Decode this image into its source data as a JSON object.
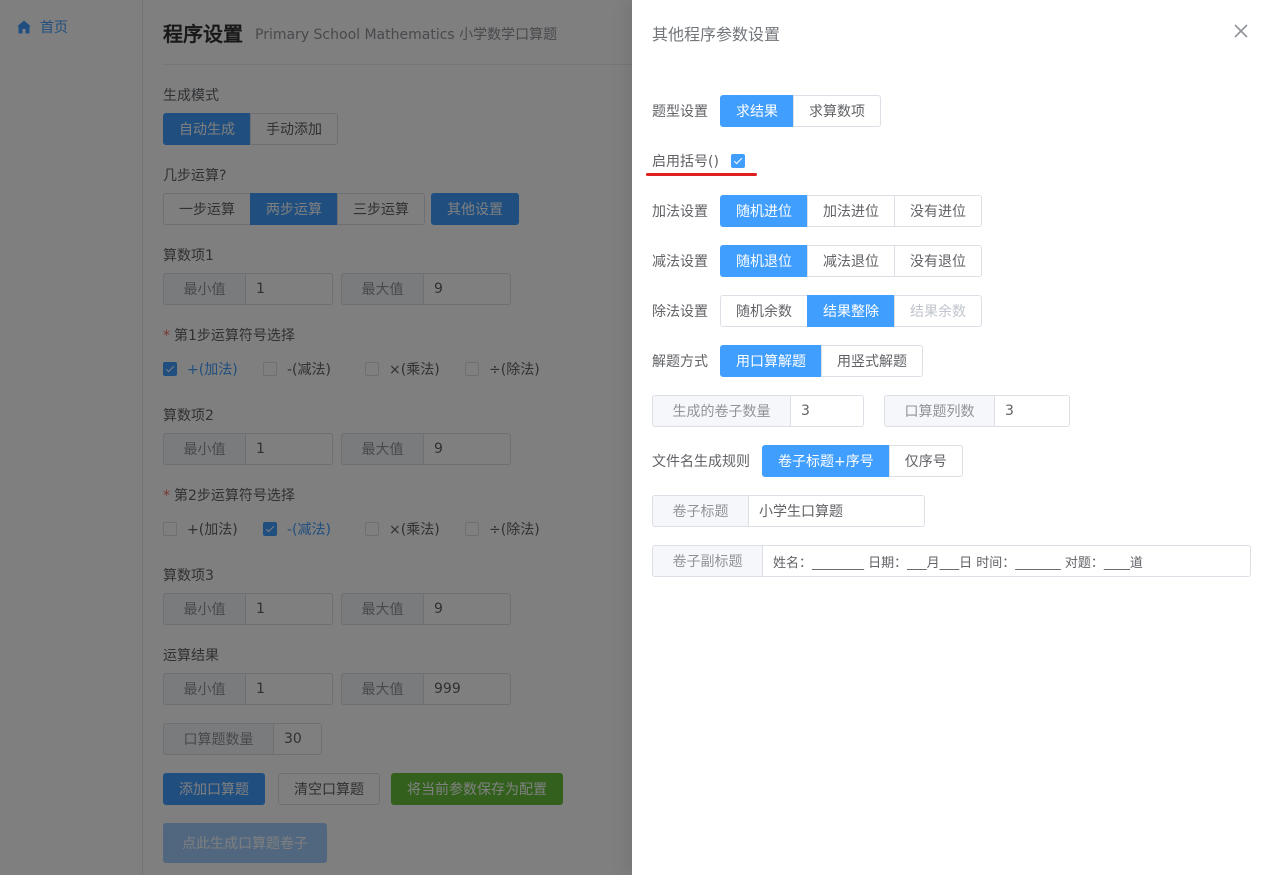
{
  "nav": {
    "home": "首页"
  },
  "page": {
    "title": "程序设置",
    "subtitle": "Primary School Mathematics 小学数学口算题"
  },
  "form": {
    "mode": {
      "label": "生成模式",
      "options": [
        "自动生成",
        "手动添加"
      ]
    },
    "steps": {
      "label": "几步运算?",
      "options": [
        "一步运算",
        "两步运算",
        "三步运算"
      ],
      "other": "其他设置"
    },
    "term1": {
      "label": "算数项1",
      "min_label": "最小值",
      "min": "1",
      "max_label": "最大值",
      "max": "9"
    },
    "op1": {
      "label": "第1步运算符号选择",
      "options": [
        "+(加法)",
        "-(减法)",
        "×(乘法)",
        "÷(除法)"
      ]
    },
    "term2": {
      "label": "算数项2",
      "min_label": "最小值",
      "min": "1",
      "max_label": "最大值",
      "max": "9"
    },
    "op2": {
      "label": "第2步运算符号选择",
      "options": [
        "+(加法)",
        "-(减法)",
        "×(乘法)",
        "÷(除法)"
      ]
    },
    "term3": {
      "label": "算数项3",
      "min_label": "最小值",
      "min": "1",
      "max_label": "最大值",
      "max": "9"
    },
    "result": {
      "label": "运算结果",
      "min_label": "最小值",
      "min": "1",
      "max_label": "最大值",
      "max": "999"
    },
    "count": {
      "label": "口算题数量",
      "value": "30"
    },
    "actions": {
      "add": "添加口算题",
      "clear": "清空口算题",
      "save": "将当前参数保存为配置",
      "generate": "点此生成口算题卷子"
    }
  },
  "drawer": {
    "title": "其他程序参数设置",
    "question_type": {
      "label": "题型设置",
      "options": [
        "求结果",
        "求算数项"
      ]
    },
    "brackets": {
      "label": "启用括号()",
      "checked": true
    },
    "addition": {
      "label": "加法设置",
      "options": [
        "随机进位",
        "加法进位",
        "没有进位"
      ]
    },
    "subtraction": {
      "label": "减法设置",
      "options": [
        "随机退位",
        "减法退位",
        "没有退位"
      ]
    },
    "division": {
      "label": "除法设置",
      "options": [
        "随机余数",
        "结果整除",
        "结果余数"
      ]
    },
    "solve": {
      "label": "解题方式",
      "options": [
        "用口算解题",
        "用竖式解题"
      ]
    },
    "paper_count": {
      "label": "生成的卷子数量",
      "value": "3"
    },
    "columns": {
      "label": "口算题列数",
      "value": "3"
    },
    "filename": {
      "label": "文件名生成规则",
      "options": [
        "卷子标题+序号",
        "仅序号"
      ]
    },
    "paper_title": {
      "label": "卷子标题",
      "value": "小学生口算题"
    },
    "paper_subtitle": {
      "label": "卷子副标题",
      "value": "姓名：________ 日期：___月___日 时间：_______ 对题：____道"
    }
  },
  "colors": {
    "primary": "#409eff",
    "success": "#67c23a",
    "danger": "#f56c6c",
    "annotation": "#e02020"
  }
}
